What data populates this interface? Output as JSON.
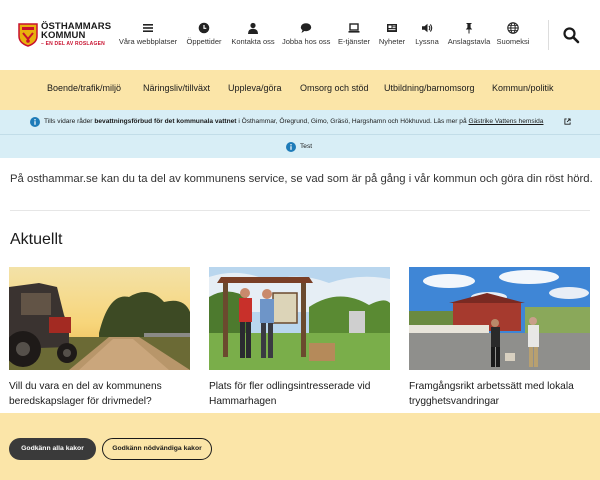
{
  "logo": {
    "line1": "ÖSTHAMMARS",
    "line2": "KOMMUN",
    "tagline": "– EN DEL AV ROSLAGEN"
  },
  "top_nav": [
    {
      "label": "Våra webbplatser",
      "icon": "menu-icon"
    },
    {
      "label": "Öppettider",
      "icon": "clock-icon"
    },
    {
      "label": "Kontakta oss",
      "icon": "person-icon"
    },
    {
      "label": "Jobba hos oss",
      "icon": "chat-bubble-icon"
    },
    {
      "label": "E-tjänster",
      "icon": "laptop-icon"
    },
    {
      "label": "Nyheter",
      "icon": "newspaper-icon"
    },
    {
      "label": "Lyssna",
      "icon": "speaker-icon"
    },
    {
      "label": "Anslagstavla",
      "icon": "pin-icon"
    },
    {
      "label": "Suomeksi",
      "icon": "globe-icon"
    }
  ],
  "main_nav": [
    "Boende/trafik/miljö",
    "Näringsliv/tillväxt",
    "Uppleva/göra",
    "Omsorg och stöd",
    "Utbildning/barnomsorg",
    "Kommun/politik"
  ],
  "alerts": {
    "water_pre": "Tills vidare råder ",
    "water_bold": "bevattningsförbud för det kommunala vattnet",
    "water_post": " i Östhammar, Öregrund, Gimo, Gräsö, Hargshamn och Hökhuvud. Läs mer på ",
    "water_link": "Gästrike Vattens hemsida",
    "test": "Test"
  },
  "intro": "På osthammar.se kan du ta del av kommunens service, se vad som är på gång i vår kommun och göra din röst hörd.",
  "news": {
    "heading": "Aktuellt",
    "cards": [
      {
        "title": "Vill du vara en del av kommunens beredskapslager för drivmedel?"
      },
      {
        "title": "Plats för fler odlingsintresserade vid Hammarhagen"
      },
      {
        "title": "Framgångsrikt arbetssätt med lokala trygghetsvandringar"
      }
    ]
  },
  "cookie": {
    "accept_all": "Godkänn alla kakor",
    "accept_needed": "Godkänn nödvändiga kakor"
  },
  "colors": {
    "nav_bg": "#fbe5a8",
    "alert_bg": "#d8eef6",
    "info_blue": "#1e7bb8",
    "brand_red": "#c8102e"
  }
}
